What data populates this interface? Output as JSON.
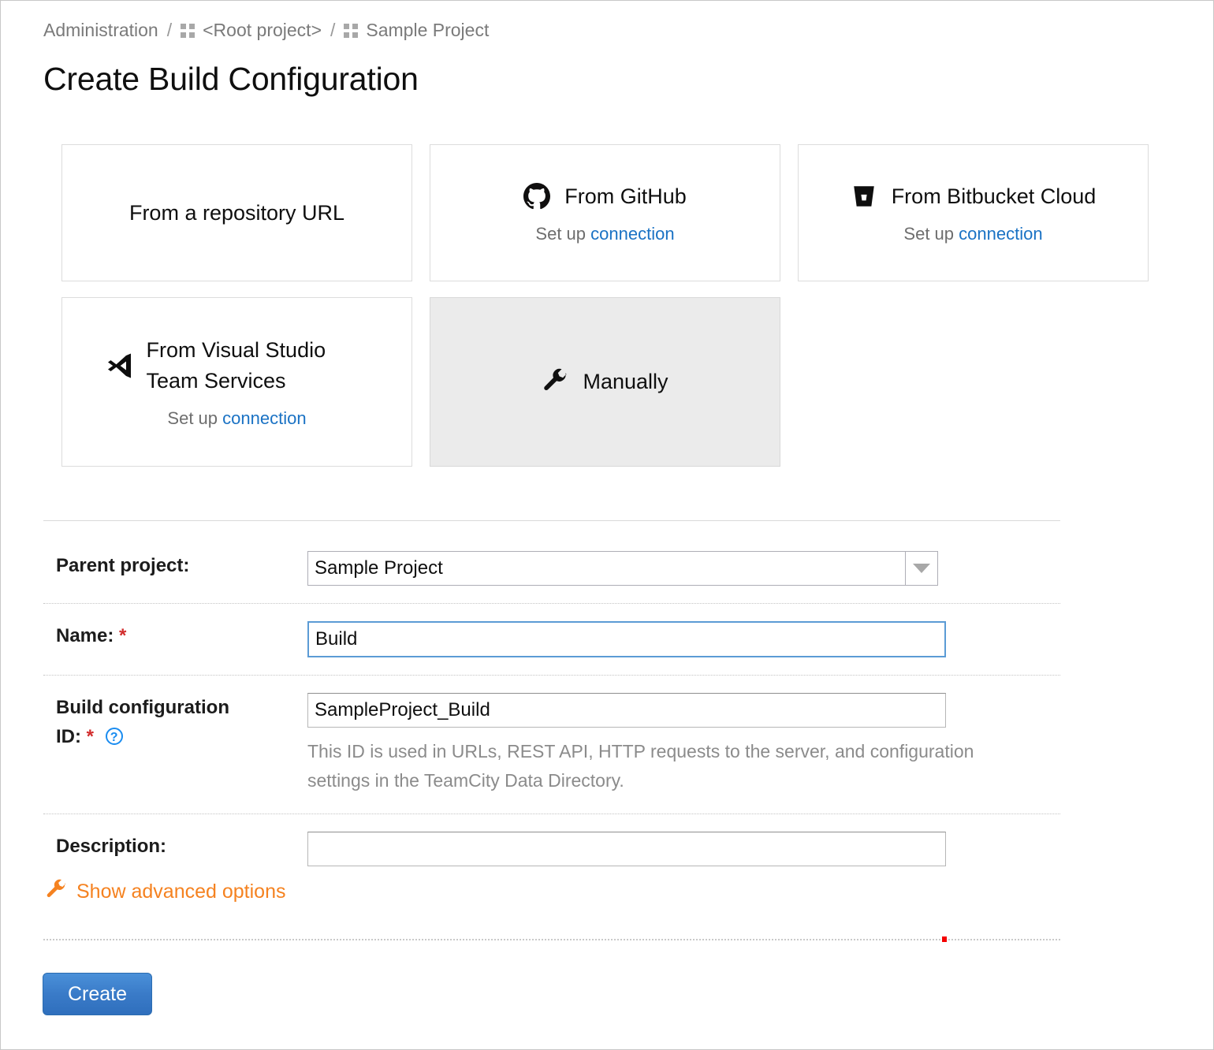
{
  "breadcrumb": {
    "administration": "Administration",
    "separator": "/",
    "root_project": "<Root project>",
    "sample_project": "Sample Project"
  },
  "page_title": "Create Build Configuration",
  "tiles": [
    {
      "id": "repository-url",
      "title": "From a repository URL",
      "icon": null,
      "subtitle_prefix": "",
      "subtitle_link": "",
      "selected": false
    },
    {
      "id": "github",
      "title": "From GitHub",
      "icon": "github-icon",
      "subtitle_prefix": "Set up ",
      "subtitle_link": "connection",
      "selected": false
    },
    {
      "id": "bitbucket-cloud",
      "title": "From Bitbucket Cloud",
      "icon": "bitbucket-icon",
      "subtitle_prefix": "Set up ",
      "subtitle_link": "connection",
      "selected": false
    },
    {
      "id": "visual-studio-team-services",
      "title": "From Visual Studio Team Services",
      "icon": "visual-studio-icon",
      "subtitle_prefix": "Set up ",
      "subtitle_link": "connection",
      "selected": false
    },
    {
      "id": "manually",
      "title": "Manually",
      "icon": "wrench-icon",
      "subtitle_prefix": "",
      "subtitle_link": "",
      "selected": true
    }
  ],
  "form": {
    "parent_project": {
      "label": "Parent project:",
      "value": "Sample Project",
      "options": [
        "Sample Project"
      ]
    },
    "name": {
      "label": "Name:",
      "required_mark": "*",
      "value": "Build",
      "placeholder": ""
    },
    "build_configuration_id": {
      "label_line1": "Build configuration",
      "label_line2": "ID:",
      "required_mark": "*",
      "help_glyph": "?",
      "value": "SampleProject_Build",
      "placeholder": "",
      "hint": "This ID is used in URLs, REST API, HTTP requests to the server, and configuration settings in the TeamCity Data Directory."
    },
    "description": {
      "label": "Description:",
      "value": "",
      "placeholder": ""
    }
  },
  "advanced_options": {
    "label": "Show advanced options",
    "icon": "wrench-icon"
  },
  "create_button": {
    "label": "Create"
  },
  "colors": {
    "link": "#1a72c4",
    "accent_orange": "#f58220",
    "required_red": "#d22d2d",
    "help_blue": "#1a8cf0",
    "selected_tile_bg": "#ebebeb",
    "focus_border": "#5b9bd5",
    "button_blue": "#3a7bc8"
  }
}
